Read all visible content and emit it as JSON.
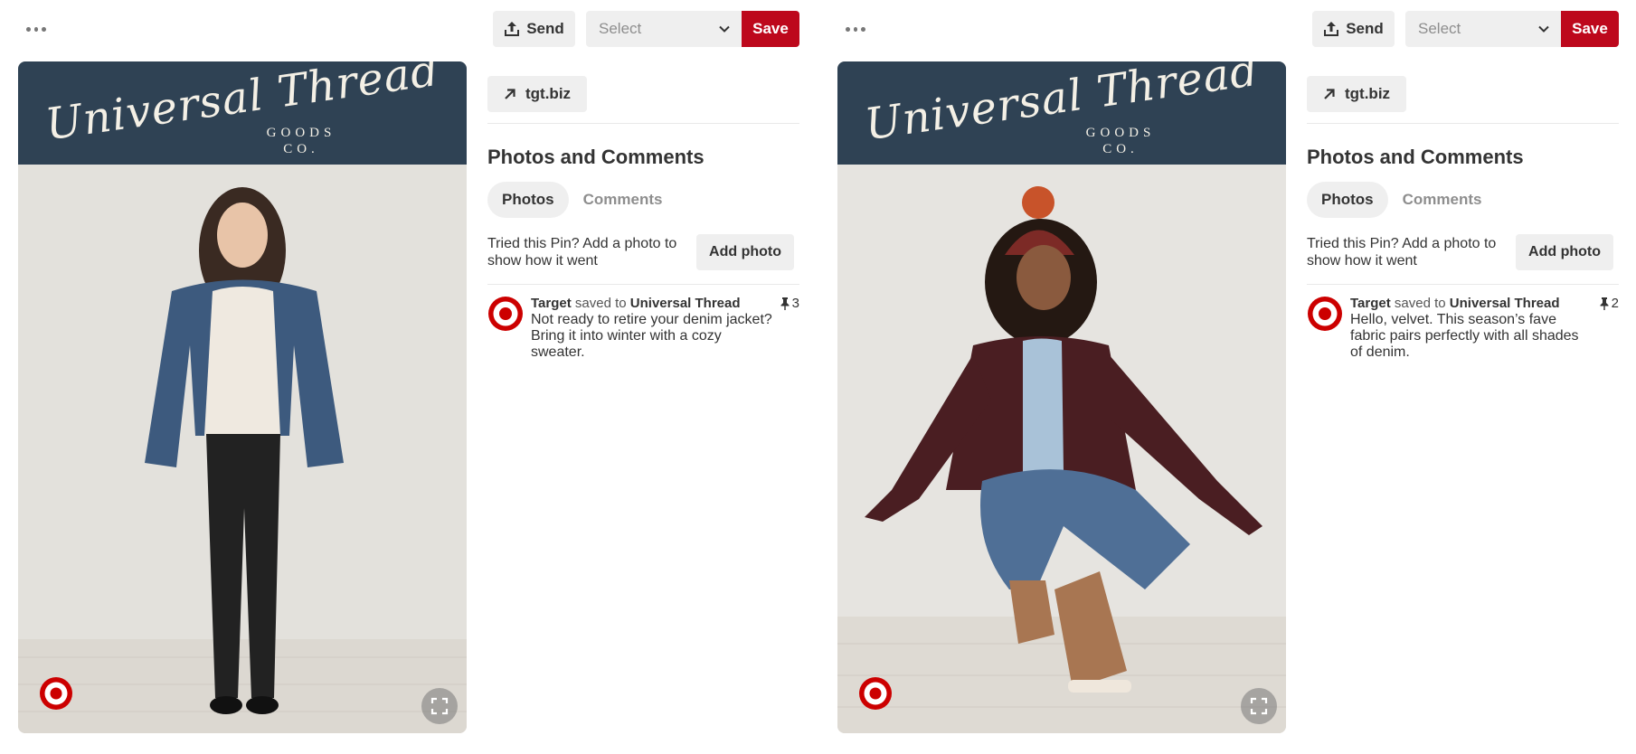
{
  "toolbar": {
    "send_label": "Send",
    "select_placeholder": "Select",
    "save_label": "Save"
  },
  "brand": {
    "script_text": "Universal Thread",
    "sub_line1": "GOODS",
    "sub_line2": "CO."
  },
  "colors": {
    "save_red": "#bd081c",
    "banner_navy": "#2f4254",
    "button_gray": "#efefef"
  },
  "pins": [
    {
      "link_label": "tgt.biz",
      "section_title": "Photos and Comments",
      "tabs": [
        "Photos",
        "Comments"
      ],
      "active_tab": "Photos",
      "tried_text": "Tried this Pin? Add a photo to show how it went",
      "add_photo_label": "Add photo",
      "saved_by": "Target",
      "saved_to_text": "saved to",
      "board": "Universal Thread",
      "description": "Not ready to retire your denim jacket? Bring it into winter with a cozy sweater.",
      "repin_count": "3"
    },
    {
      "link_label": "tgt.biz",
      "section_title": "Photos and Comments",
      "tabs": [
        "Photos",
        "Comments"
      ],
      "active_tab": "Photos",
      "tried_text": "Tried this Pin? Add a photo to show how it went",
      "add_photo_label": "Add photo",
      "saved_by": "Target",
      "saved_to_text": "saved to",
      "board": "Universal Thread",
      "description": "Hello, velvet. This season’s fave fabric pairs perfectly with all shades of denim.",
      "repin_count": "2"
    }
  ]
}
